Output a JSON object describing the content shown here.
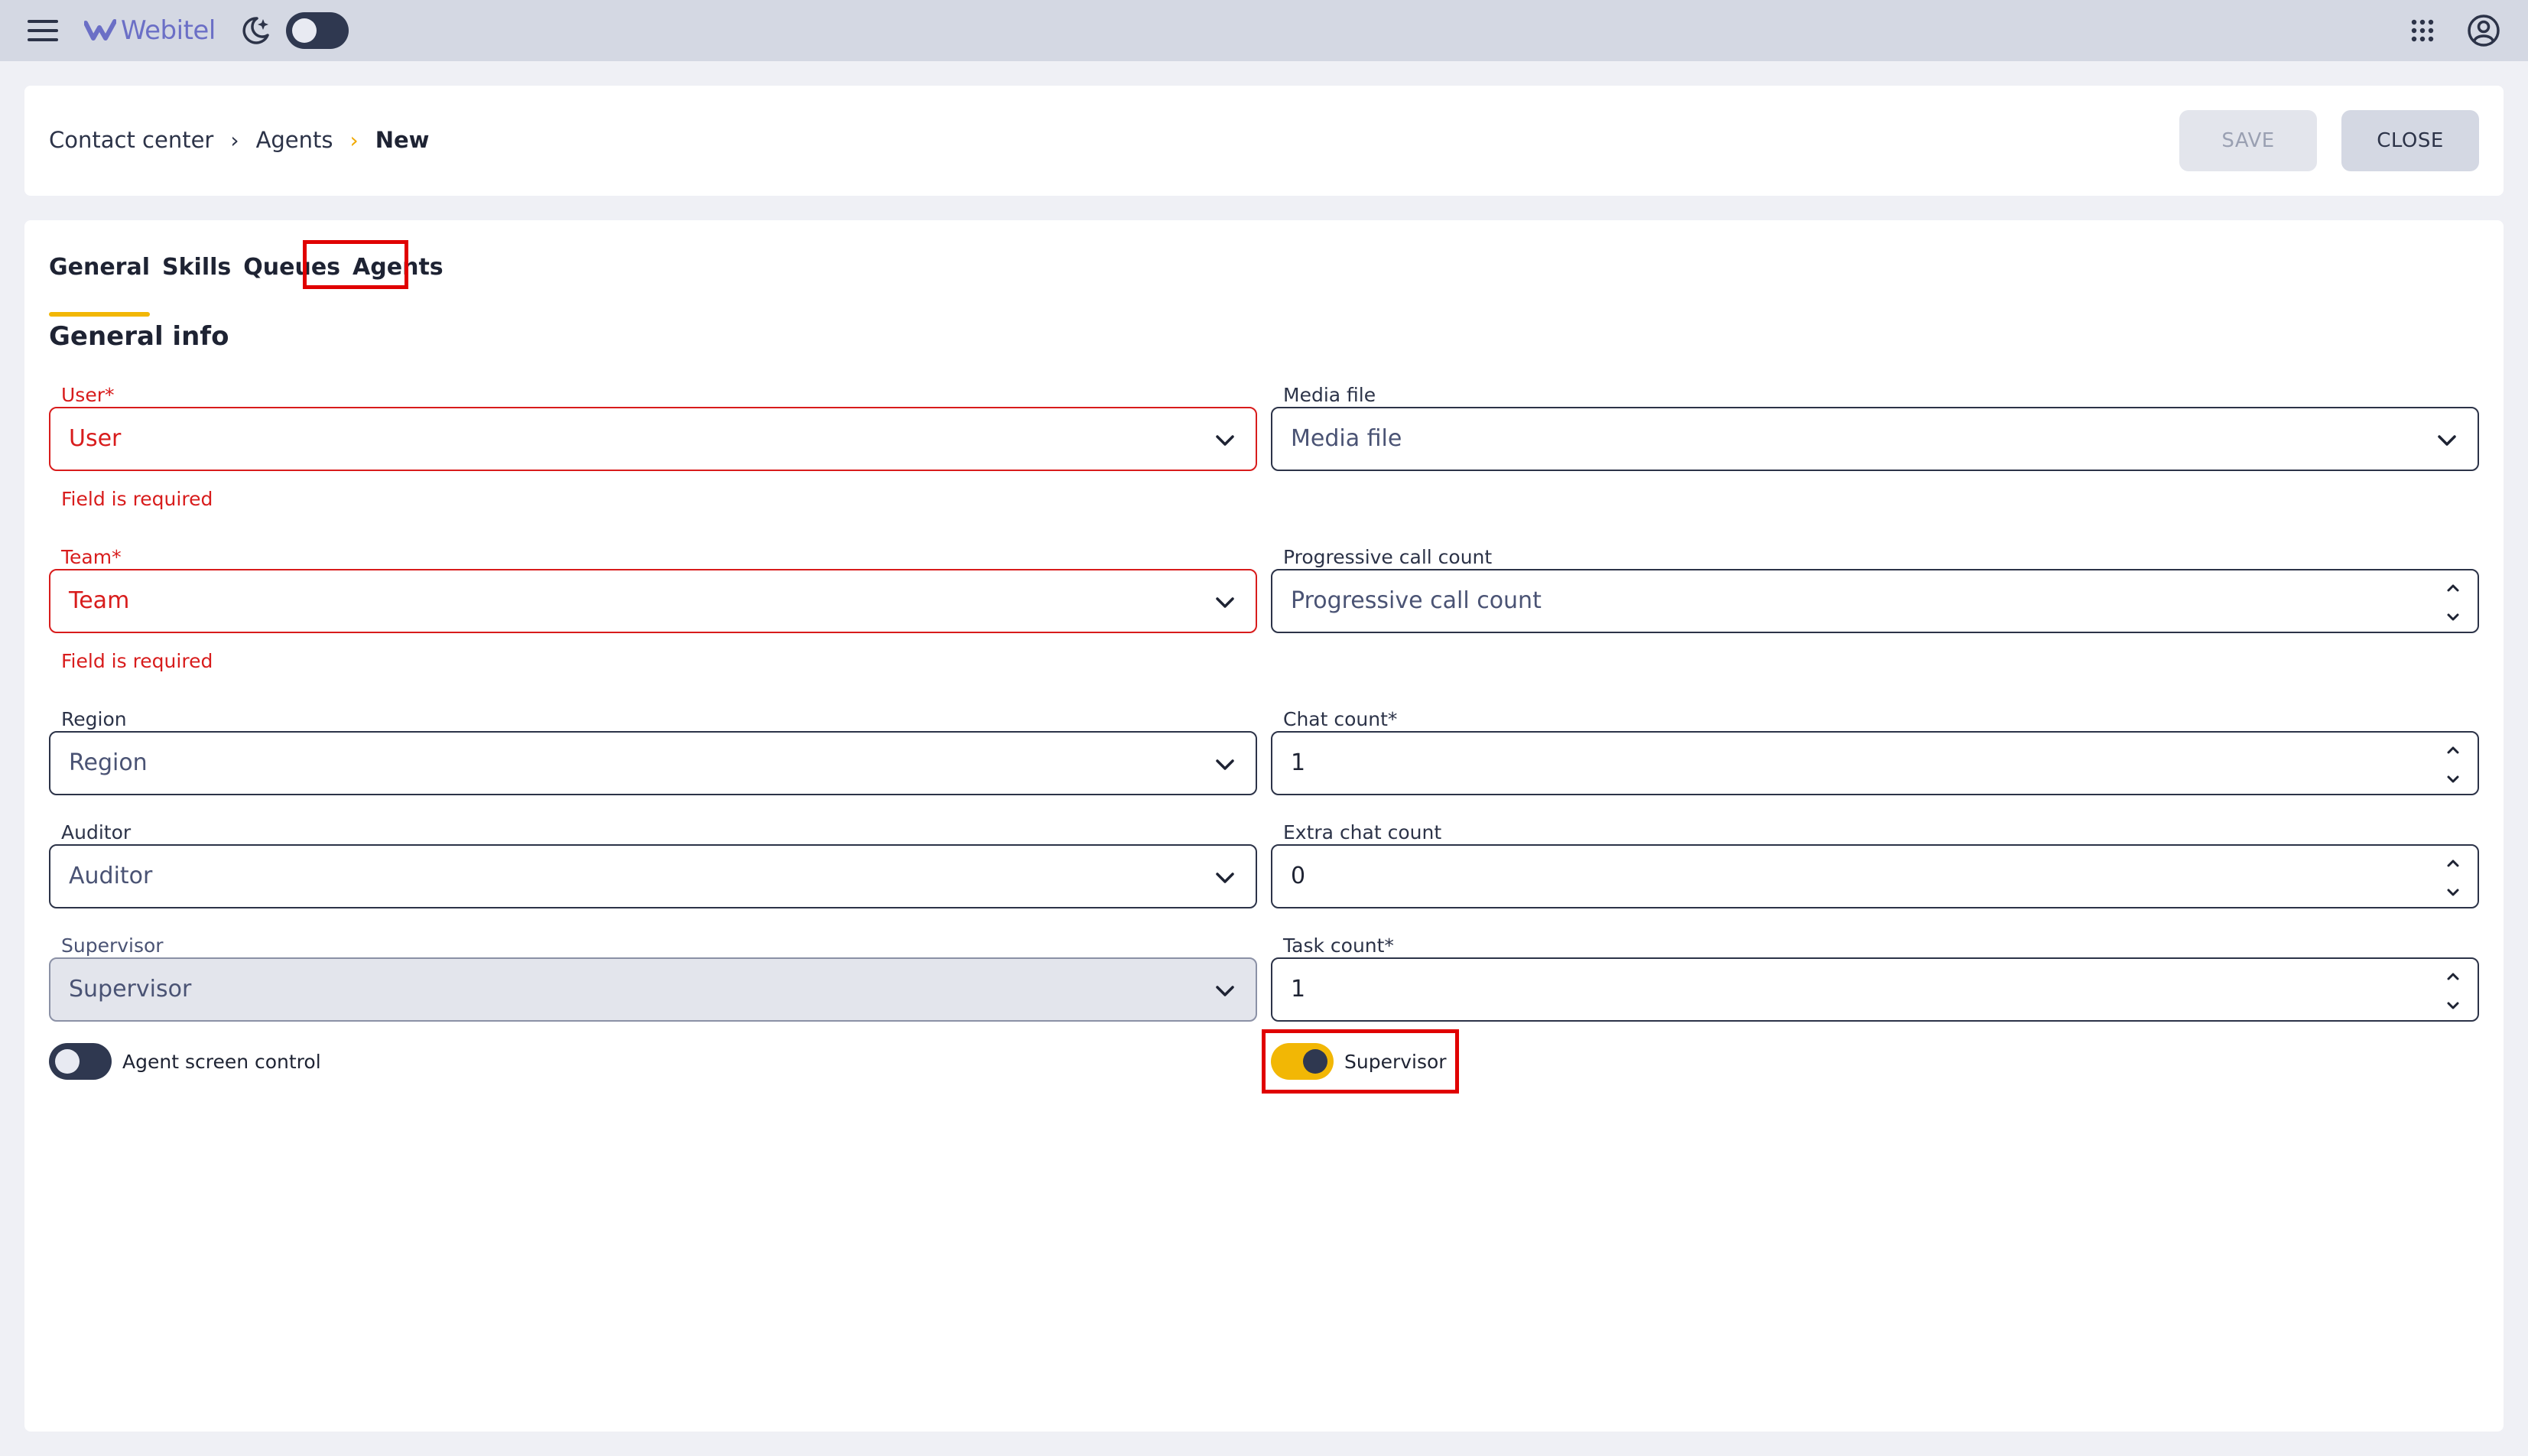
{
  "app": {
    "logo_text": "Webitel"
  },
  "header": {
    "breadcrumb": [
      "Contact center",
      "Agents",
      "New"
    ],
    "save_label": "SAVE",
    "close_label": "CLOSE"
  },
  "tabs": [
    "General",
    "Skills",
    "Queues",
    "Agents"
  ],
  "active_tab": "General",
  "section_title": "General info",
  "form": {
    "user": {
      "label": "User*",
      "value": "User",
      "error": "Field is required"
    },
    "team": {
      "label": "Team*",
      "value": "Team",
      "error": "Field is required"
    },
    "region": {
      "label": "Region",
      "value": "Region"
    },
    "auditor": {
      "label": "Auditor",
      "value": "Auditor"
    },
    "supervisor": {
      "label": "Supervisor",
      "value": "Supervisor"
    },
    "media_file": {
      "label": "Media file",
      "value": "Media file"
    },
    "progressive_call_count": {
      "label": "Progressive call count",
      "value": "Progressive call count"
    },
    "chat_count": {
      "label": "Chat count*",
      "value": "1"
    },
    "extra_chat_count": {
      "label": "Extra chat count",
      "value": "0"
    },
    "task_count": {
      "label": "Task count*",
      "value": "1"
    },
    "agent_screen_control": {
      "label": "Agent screen control",
      "enabled": false
    },
    "is_supervisor": {
      "label": "Supervisor",
      "enabled": true
    }
  },
  "colors": {
    "accent": "#f2b705",
    "error": "#d81c1c",
    "highlight": "#e00000",
    "topbar": "#d4d8e3"
  }
}
